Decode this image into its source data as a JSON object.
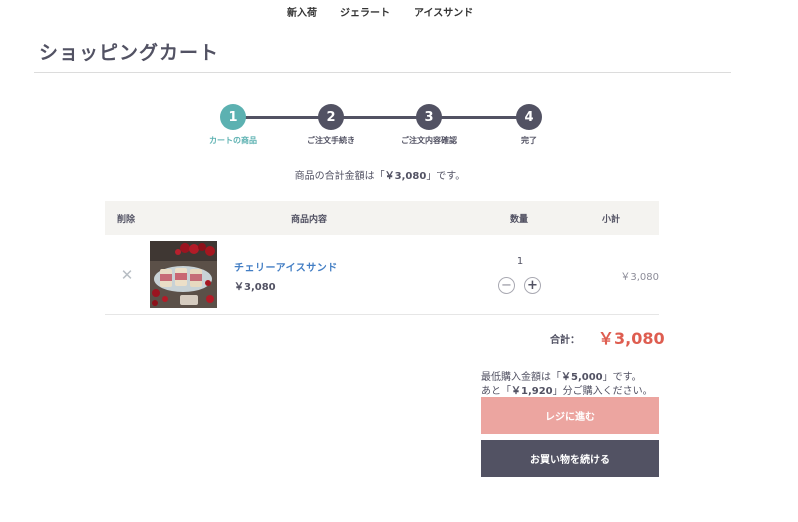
{
  "nav": {
    "items": [
      "新入荷",
      "ジェラート",
      "アイスサンド"
    ]
  },
  "page": {
    "title": "ショッピングカート"
  },
  "steps": [
    {
      "number": "1",
      "label": "カートの商品"
    },
    {
      "number": "2",
      "label": "ご注文手続き"
    },
    {
      "number": "3",
      "label": "ご注文内容確認"
    },
    {
      "number": "4",
      "label": "完了"
    }
  ],
  "total_message": {
    "prefix": "商品の合計金額は「",
    "amount": "￥3,080",
    "suffix": "」です。"
  },
  "table": {
    "headers": {
      "remove": "削除",
      "product": "商品内容",
      "qty": "数量",
      "subtotal": "小計"
    },
    "items": [
      {
        "name": "チェリーアイスサンド",
        "price": "￥3,080",
        "quantity": "1",
        "subtotal": "￥3,080"
      }
    ]
  },
  "summary": {
    "label": "合計：",
    "value": "￥3,080"
  },
  "minimum_note": {
    "line1_prefix": "最低購入金額は「",
    "line1_amount": "￥5,000",
    "line1_suffix": "」です。",
    "line2_prefix": "あと「",
    "line2_amount": "￥1,920",
    "line2_suffix": "」分ご購入ください。"
  },
  "buttons": {
    "checkout": "レジに進む",
    "continue": "お買い物を続ける"
  },
  "colors": {
    "accent": "#5cb1b1",
    "dark": "#525263",
    "price_red": "#de5d50",
    "checkout_disabled": "#eca5a0",
    "link": "#437ec4"
  }
}
